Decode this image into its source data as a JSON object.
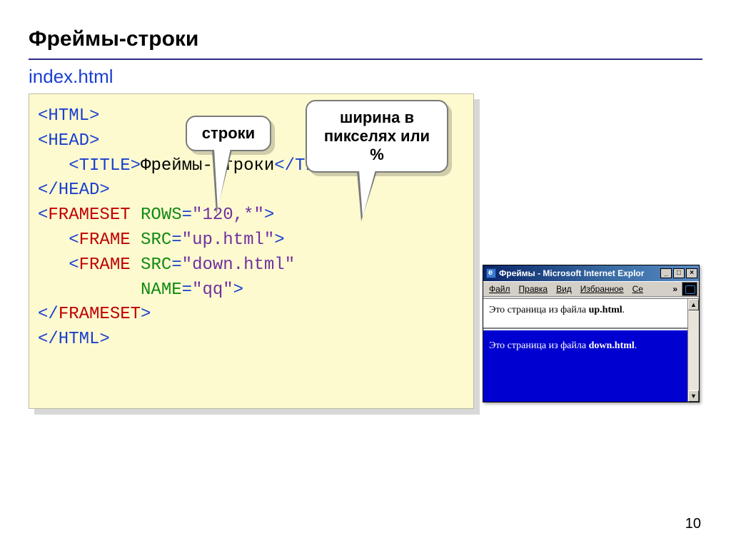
{
  "title": "Фреймы-строки",
  "filename": "index.html",
  "callouts": {
    "rows": "строки",
    "width": "ширина в пикселях или %"
  },
  "code": {
    "l1_open": "<HTML>",
    "l2_open": "<HEAD>",
    "l3_indent": "   ",
    "l3_title_open": "<TITLE>",
    "l3_title_text": "Фреймы-строки",
    "l3_title_close": "</TITLE>",
    "l4_close": "</HEAD>",
    "l5_lt": "<",
    "l5_tag": "FRAMESET",
    "l5_sp": " ",
    "l5_attr": "ROWS",
    "l5_eq": "=",
    "l5_val": "\"120,*\"",
    "l5_gt": ">",
    "l6_indent": "   ",
    "l6_lt": "<",
    "l6_tag": "FRAME",
    "l6_sp": " ",
    "l6_attr": "SRC",
    "l6_eq": "=",
    "l6_val": "\"up.html\"",
    "l6_gt": ">",
    "l7_indent": "   ",
    "l7_lt": "<",
    "l7_tag": "FRAME",
    "l7_sp": " ",
    "l7_attr": "SRC",
    "l7_eq": "=",
    "l7_val": "\"down.html\"",
    "l8_indent": "          ",
    "l8_attr": "NAME",
    "l8_eq": "=",
    "l8_val": "\"qq\"",
    "l8_gt": ">",
    "l9_lt": "</",
    "l9_tag": "FRAMESET",
    "l9_gt": ">",
    "l10_close": "</HTML>"
  },
  "ie": {
    "title": "Фреймы - Microsoft Internet Explor",
    "min": "_",
    "max": "□",
    "close": "×",
    "menu": {
      "file": "Файл",
      "edit": "Правка",
      "view": "Вид",
      "fav": "Избранное",
      "help": "Се"
    },
    "chev": "»",
    "scroll_up": "▲",
    "scroll_dn": "▼",
    "frame_top_a": "Это страница из файла ",
    "frame_top_b": "up.html",
    "frame_top_c": ".",
    "frame_bot_a": "Это страница из файла ",
    "frame_bot_b": "down.html",
    "frame_bot_c": "."
  },
  "page_number": "10"
}
